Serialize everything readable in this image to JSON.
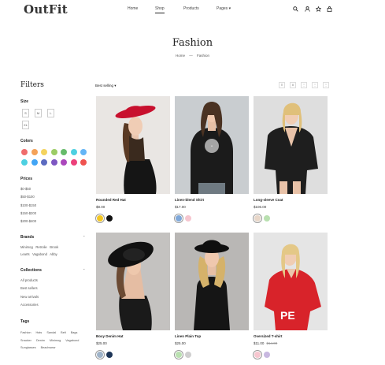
{
  "header": {
    "logo": "OutFit",
    "nav": [
      "Home",
      "Shop",
      "Products",
      "Pages ▾"
    ],
    "icons": [
      "search-icon",
      "user-icon",
      "wishlist-icon",
      "cart-icon"
    ]
  },
  "hero": {
    "title": "Fashion",
    "crumbs": [
      "Home",
      "—",
      "Fashion"
    ]
  },
  "filters": {
    "title": "Filters",
    "size_label": "Size",
    "sizes": [
      "S",
      "M",
      "L",
      "XL"
    ],
    "colors_label": "Colors",
    "colors": [
      "#ef6c6c",
      "#f4a259",
      "#f4d35e",
      "#9ccc65",
      "#66bb6a",
      "#4dd0e1",
      "#64b5f6",
      "#4dd0e1",
      "#42a5f5",
      "#5c6bc0",
      "#7e57c2",
      "#ab47bc",
      "#ec407a",
      "#ef5350"
    ],
    "prices_label": "Prices",
    "prices": [
      "$0-$50",
      "$50-$100",
      "$100-$150",
      "$150-$200",
      "$200-$400"
    ],
    "brands_label": "Brands",
    "brands": [
      "Minimog",
      "Retrolie",
      "Brook",
      "Learts",
      "Vagabond",
      "Abby"
    ],
    "collections_label": "Collections",
    "collections": [
      "All products",
      "Best sellers",
      "New arrivals",
      "Accessories"
    ],
    "tags_label": "Tags",
    "tags": [
      "Fashion",
      "Hats",
      "Sandal",
      "Belt",
      "Bags",
      "Snacker",
      "Denim",
      "Minimog",
      "Vagabond",
      "Sunglasses",
      "Beachwear"
    ]
  },
  "toolbar": {
    "sort": "Best selling ▾"
  },
  "products": [
    {
      "name": "Rounded Red Hat",
      "price": "$8.00",
      "old_price": "",
      "swatches": [
        "#f3c623",
        "#111111"
      ]
    },
    {
      "name": "Linen-blend Shirt",
      "price": "$17.00",
      "old_price": "",
      "swatches": [
        "#7fa8d9",
        "#f6c6cf"
      ]
    },
    {
      "name": "Long-sleeve Coat",
      "price": "$106.00",
      "old_price": "",
      "swatches": [
        "#e8d7c9",
        "#b9e0b0"
      ]
    },
    {
      "name": "Boxy Denim Hat",
      "price": "$25.00",
      "old_price": "",
      "swatches": [
        "#9fb3c8",
        "#1d3557"
      ]
    },
    {
      "name": "Linen Plain Top",
      "price": "$25.00",
      "old_price": "",
      "swatches": [
        "#b9e0b0",
        "#cfcfcf"
      ]
    },
    {
      "name": "Oversized T-shirt",
      "price": "$11.00",
      "old_price": "$14.00",
      "swatches": [
        "#f6c6cf",
        "#c8b8e0"
      ]
    }
  ]
}
